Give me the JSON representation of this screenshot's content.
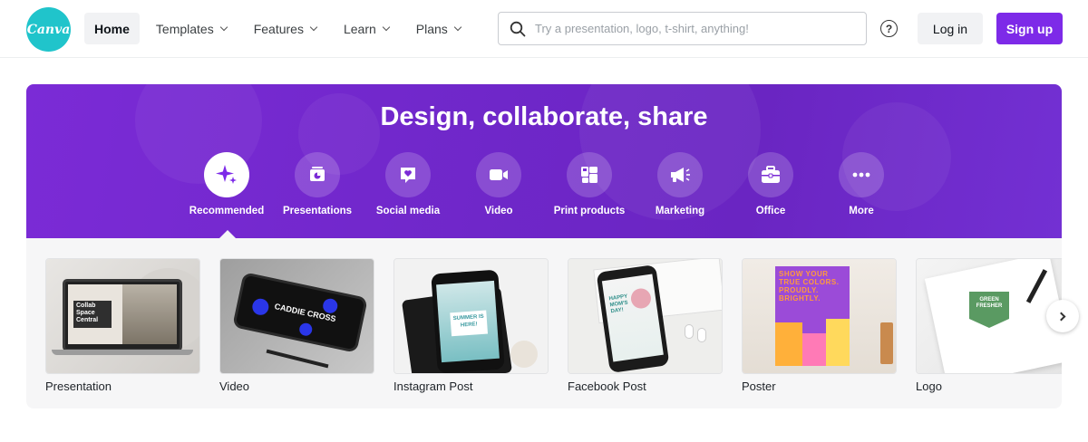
{
  "header": {
    "logo_text": "Canva",
    "nav": [
      {
        "label": "Home",
        "active": true,
        "dropdown": false
      },
      {
        "label": "Templates",
        "active": false,
        "dropdown": true
      },
      {
        "label": "Features",
        "active": false,
        "dropdown": true
      },
      {
        "label": "Learn",
        "active": false,
        "dropdown": true
      },
      {
        "label": "Plans",
        "active": false,
        "dropdown": true
      }
    ],
    "search_placeholder": "Try a presentation, logo, t-shirt, anything!",
    "help_icon": "question-circle-icon",
    "login_label": "Log in",
    "signup_label": "Sign up",
    "brand_color": "#7d2ae8",
    "logo_color": "#20c4cb"
  },
  "hero": {
    "title": "Design, collaborate, share",
    "categories": [
      {
        "label": "Recommended",
        "icon": "sparkle-icon",
        "active": true
      },
      {
        "label": "Presentations",
        "icon": "presentation-icon",
        "active": false
      },
      {
        "label": "Social media",
        "icon": "heart-bubble-icon",
        "active": false
      },
      {
        "label": "Video",
        "icon": "video-camera-icon",
        "active": false
      },
      {
        "label": "Print products",
        "icon": "print-icon",
        "active": false
      },
      {
        "label": "Marketing",
        "icon": "megaphone-icon",
        "active": false
      },
      {
        "label": "Office",
        "icon": "briefcase-icon",
        "active": false
      },
      {
        "label": "More",
        "icon": "more-dots-icon",
        "active": false
      }
    ]
  },
  "designs": [
    {
      "label": "Presentation",
      "thumb_text": "Collab Space Central"
    },
    {
      "label": "Video",
      "thumb_text": "CADDIE CROSS"
    },
    {
      "label": "Instagram Post",
      "thumb_text": "SUMMER IS HERE!"
    },
    {
      "label": "Facebook Post",
      "thumb_text": "HAPPY MOM'S DAY!"
    },
    {
      "label": "Poster",
      "thumb_text": "SHOW YOUR TRUE COLORS. PROUDLY. BRIGHTLY."
    },
    {
      "label": "Logo",
      "thumb_text": "GREEN FRESHER"
    }
  ],
  "next_icon": "chevron-right-icon"
}
